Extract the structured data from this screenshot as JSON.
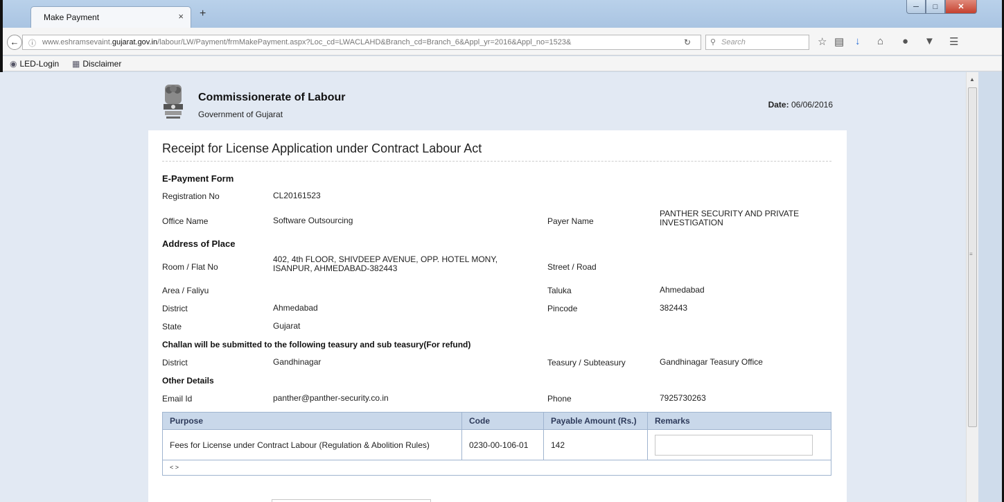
{
  "browser": {
    "tab_title": "Make Payment",
    "tab_close": "×",
    "new_tab": "+",
    "url_prefix": "www.eshramsevaint.",
    "url_domain": "gujarat.gov.in",
    "url_path": "/labour/LW/Payment/frmMakePayment.aspx?Loc_cd=LWACLAHD&Branch_cd=Branch_6&Appl_yr=2016&Appl_no=1523&",
    "search_placeholder": "Search",
    "bookmarks": [
      "LED-Login",
      "Disclaimer"
    ]
  },
  "header": {
    "org_name": "Commissionerate of Labour",
    "org_sub": "Government of Gujarat",
    "date_label": "Date:",
    "date_value": "06/06/2016"
  },
  "receipt": {
    "title": "Receipt for License Application under Contract Labour Act",
    "epayment_heading": "E-Payment Form",
    "registration_label": "Registration No",
    "registration_value": "CL20161523",
    "office_label": "Office Name",
    "office_value": "Software Outsourcing",
    "payer_label": "Payer Name",
    "payer_value_line1": "PANTHER SECURITY AND PRIVATE",
    "payer_value_line2": "INVESTIGATION",
    "address_heading": "Address of Place",
    "room_label": "Room / Flat No",
    "room_value_line1": "402, 4th FLOOR, SHIVDEEP AVENUE, OPP. HOTEL MONY,",
    "room_value_line2": "ISANPUR, AHMEDABAD-382443",
    "street_label": "Street / Road",
    "area_label": "Area / Faliyu",
    "taluka_label": "Taluka",
    "taluka_value": "Ahmedabad",
    "district_label": "District",
    "district_value": "Ahmedabad",
    "pincode_label": "Pincode",
    "pincode_value": "382443",
    "state_label": "State",
    "state_value": "Gujarat",
    "challan_heading": "Challan will be submitted to the following teasury and sub teasury(For refund)",
    "challan_district_label": "District",
    "challan_district_value": "Gandhinagar",
    "treasury_label": "Teasury / Subteasury",
    "treasury_value": "Gandhinagar Teasury Office",
    "other_heading": "Other Details",
    "email_label": "Email Id",
    "email_value": "panther@panther-security.co.in",
    "phone_label": "Phone",
    "phone_value": "7925730263"
  },
  "payment_table": {
    "headers": [
      "Purpose",
      "Code",
      "Payable Amount (Rs.)",
      "Remarks"
    ],
    "rows": [
      {
        "purpose": "Fees for License under Contract Labour (Regulation & Abolition Rules)",
        "code": "0230-00-106-01",
        "amount": "142"
      }
    ],
    "pager": "< >"
  }
}
